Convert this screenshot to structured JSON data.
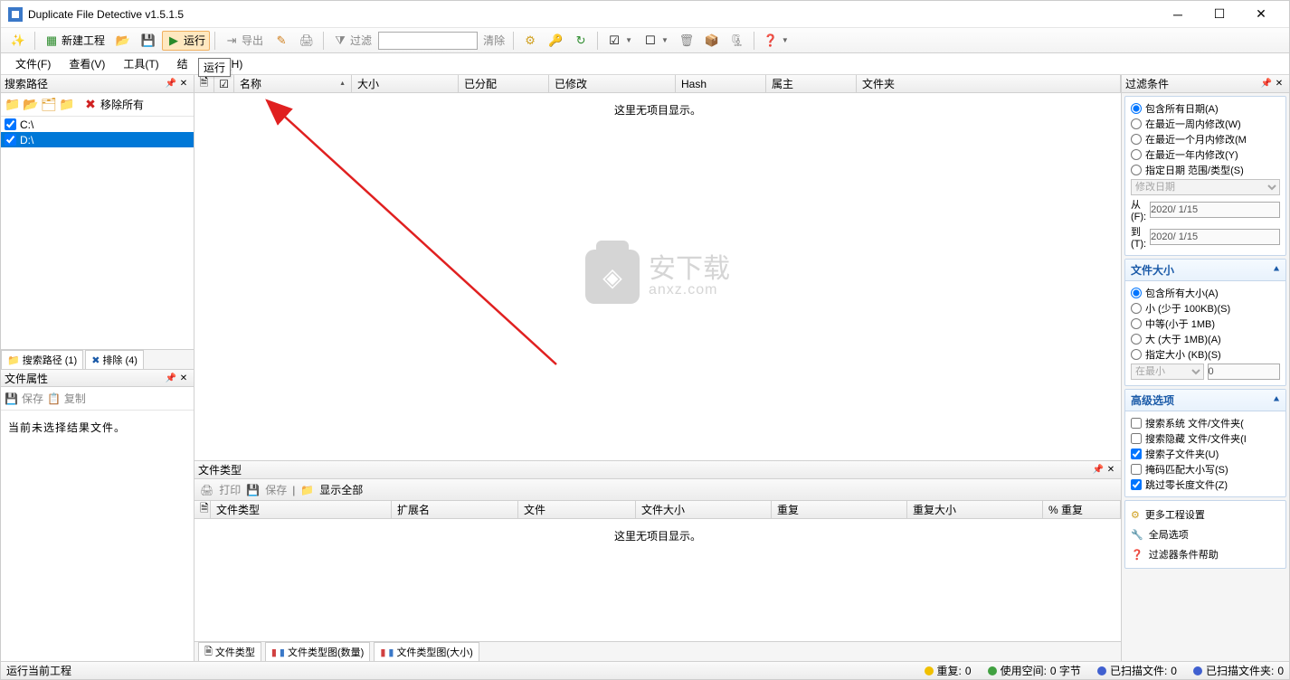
{
  "title": "Duplicate File Detective v1.5.1.5",
  "toolbar": {
    "new_project": "新建工程",
    "run": "运行",
    "export": "导出",
    "filter": "过滤",
    "clear": "清除"
  },
  "tooltip": "运行",
  "menu": {
    "file": "文件(F)",
    "view": "查看(V)",
    "tools": "工具(T)",
    "results": "结",
    "help": "帮助(H)"
  },
  "left": {
    "search_paths_title": "搜索路径",
    "remove_all": "移除所有",
    "paths": [
      "C:\\",
      "D:\\"
    ],
    "tab_search": "搜索路径 (1)",
    "tab_exclude": "排除 (4)",
    "file_props_title": "文件属性",
    "save": "保存",
    "copy": "复制",
    "no_selection": "当前未选择结果文件。"
  },
  "results": {
    "cols": {
      "name": "名称",
      "size": "大小",
      "allocated": "已分配",
      "modified": "已修改",
      "hash": "Hash",
      "owner": "属主",
      "folder": "文件夹"
    },
    "empty": "这里无项目显示。"
  },
  "watermark": {
    "main": "安下载",
    "sub": "anxz.com"
  },
  "filetypes": {
    "title": "文件类型",
    "print": "打印",
    "save": "保存",
    "show_all": "显示全部",
    "cols": {
      "type": "文件类型",
      "ext": "扩展名",
      "files": "文件",
      "size": "文件大小",
      "dup": "重复",
      "dupsize": "重复大小",
      "pct": "% 重复"
    },
    "empty": "这里无项目显示。",
    "tab1": "文件类型",
    "tab2": "文件类型图(数量)",
    "tab3": "文件类型图(大小)"
  },
  "right": {
    "filter_title": "过滤条件",
    "date": {
      "all": "包含所有日期(A)",
      "week": "在最近一周内修改(W)",
      "month": "在最近一个月内修改(M",
      "year": "在最近一年内修改(Y)",
      "range": "指定日期 范围/类型(S)",
      "type_sel": "修改日期",
      "from_lbl": "从(F):",
      "from_val": "2020/ 1/15",
      "to_lbl": "到(T):",
      "to_val": "2020/ 1/15"
    },
    "size": {
      "title": "文件大小",
      "all": "包含所有大小(A)",
      "small": "小 (少于 100KB)(S)",
      "medium": "中等(小于 1MB)",
      "large": "大 (大于 1MB)(A)",
      "spec": "指定大小 (KB)(S)",
      "at_least": "在最小",
      "val": "0"
    },
    "adv": {
      "title": "高级选项",
      "sys": "搜索系统 文件/文件夹(",
      "hidden": "搜索隐藏 文件/文件夹(I",
      "sub": "搜索子文件夹(U)",
      "case": "掩码匹配大小写(S)",
      "zero": "跳过零长度文件(Z)"
    },
    "links": {
      "more": "更多工程设置",
      "global": "全局选项",
      "help": "过滤器条件帮助"
    }
  },
  "status": {
    "running": "运行当前工程",
    "dup": "重复:",
    "dup_v": "0",
    "used": "使用空间:",
    "used_v": "0 字节",
    "s_files": "已扫描文件:",
    "s_files_v": "0",
    "s_dirs": "已扫描文件夹:",
    "s_dirs_v": "0"
  }
}
